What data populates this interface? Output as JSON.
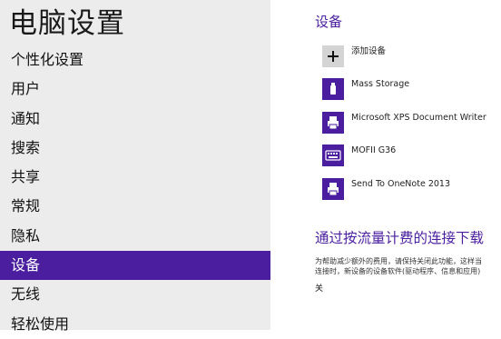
{
  "sidebar": {
    "title": "电脑设置",
    "items": [
      {
        "label": "个性化设置",
        "selected": false
      },
      {
        "label": "用户",
        "selected": false
      },
      {
        "label": "通知",
        "selected": false
      },
      {
        "label": "搜索",
        "selected": false
      },
      {
        "label": "共享",
        "selected": false
      },
      {
        "label": "常规",
        "selected": false
      },
      {
        "label": "隐私",
        "selected": false
      },
      {
        "label": "设备",
        "selected": true
      },
      {
        "label": "无线",
        "selected": false
      },
      {
        "label": "轻松使用",
        "selected": false
      }
    ]
  },
  "devices": {
    "title": "设备",
    "add_label": "添加设备",
    "list": [
      {
        "label": "Mass Storage",
        "icon": "usb-drive-icon"
      },
      {
        "label": "Microsoft XPS Document Writer",
        "icon": "printer-icon"
      },
      {
        "label": "MOFII G36",
        "icon": "keyboard-icon"
      },
      {
        "label": "Send To OneNote 2013",
        "icon": "printer-icon"
      }
    ]
  },
  "metered": {
    "title": "通过按流量计费的连接下载",
    "desc_line1": "为帮助减少额外的费用，请保持关闭此功能，这样当",
    "desc_line2": "连接时，新设备的设备软件(驱动程序、信息和应用)",
    "state": "关"
  },
  "colors": {
    "accent": "#4b1ea0",
    "sidebar_bg": "#ececec"
  }
}
